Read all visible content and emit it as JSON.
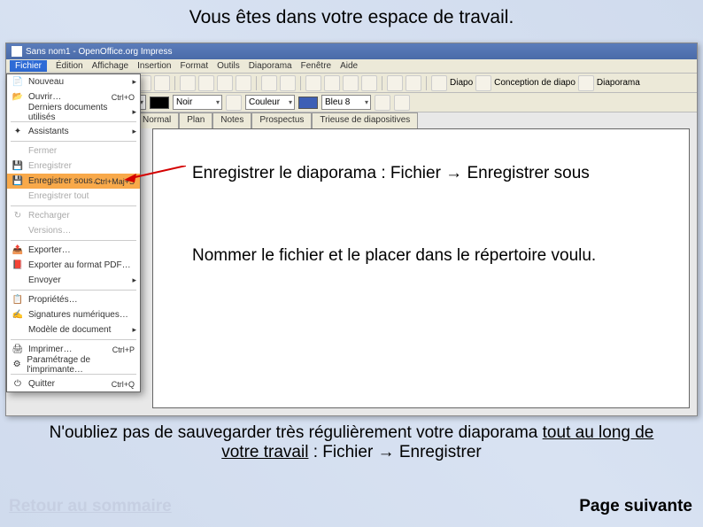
{
  "slide": {
    "title": "Vous êtes dans votre espace de travail.",
    "instruction1": "Enregistrer le diaporama : Fichier → Enregistrer sous",
    "instruction2": "Nommer le fichier et le placer  dans le répertoire voulu.",
    "reminder_a": "N'oubliez pas de sauvegarder très régulièrement votre diaporama ",
    "reminder_u1": "tout au long de votre travail",
    "reminder_b": " : Fichier → Enregistrer",
    "nav_prev": "Retour au sommaire",
    "nav_next": "Page suivante"
  },
  "app": {
    "title": "Sans nom1 - OpenOffice.org Impress",
    "menu": {
      "fichier": "Fichier",
      "edition": "Édition",
      "affichage": "Affichage",
      "insertion": "Insertion",
      "format": "Format",
      "outils": "Outils",
      "diaporama": "Diaporama",
      "fenetre": "Fenêtre",
      "aide": "Aide"
    },
    "views": {
      "normal": "Normal",
      "plan": "Plan",
      "notes": "Notes",
      "prospectus": "Prospectus",
      "trieuse": "Trieuse de diapositives"
    },
    "tb2": {
      "noir": "Noir",
      "couleur": "Couleur",
      "bleu8": "Bleu 8"
    },
    "tbr": {
      "diapo": "Diapo",
      "conception": "Conception de diapo",
      "diaporama": "Diaporama"
    }
  },
  "menu_items": {
    "nouveau": "Nouveau",
    "ouvrir": "Ouvrir…",
    "recents": "Derniers documents utilisés",
    "assistants": "Assistants",
    "fermer": "Fermer",
    "enregistrer": "Enregistrer",
    "enregistrer_sous": "Enregistrer sous…",
    "enregistrer_tout": "Enregistrer tout",
    "recharger": "Recharger",
    "versions": "Versions…",
    "exporter": "Exporter…",
    "export_pdf": "Exporter au format PDF…",
    "envoyer": "Envoyer",
    "proprietes": "Propriétés…",
    "signatures": "Signatures numériques…",
    "modele": "Modèle de document",
    "imprimer": "Imprimer…",
    "param_impr": "Paramétrage de l'imprimante…",
    "quitter": "Quitter"
  },
  "shortcuts": {
    "ouvrir": "Ctrl+O",
    "enregistrer_sous": "Ctrl+Maj+S",
    "imprimer": "Ctrl+P",
    "quitter": "Ctrl+Q"
  }
}
